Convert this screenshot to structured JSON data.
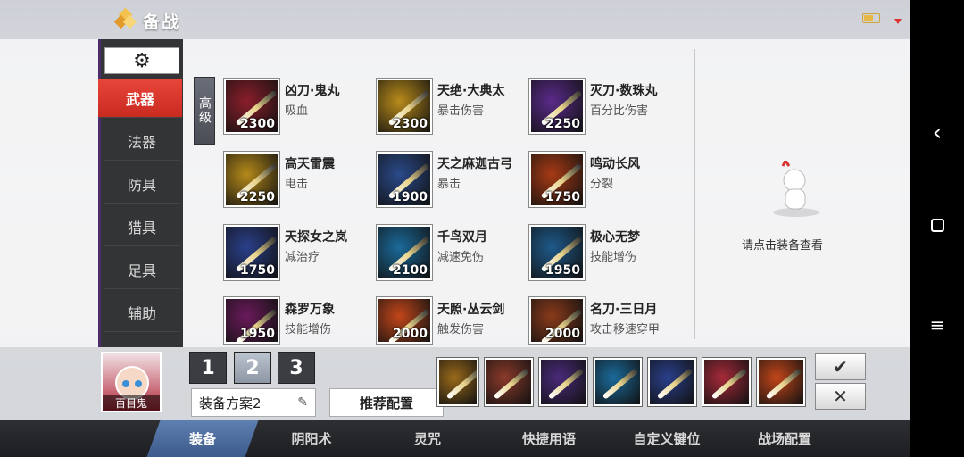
{
  "header": {
    "title": "备战"
  },
  "sidebar": {
    "settings_icon": "gear-icon",
    "categories": [
      "武器",
      "法器",
      "防具",
      "猎具",
      "足具",
      "辅助"
    ],
    "active": "武器"
  },
  "tier_tab": "高级",
  "items": [
    {
      "name": "凶刀·鬼丸",
      "desc": "吸血",
      "cost": "2300",
      "color": "#8a1e2a"
    },
    {
      "name": "天绝·大典太",
      "desc": "暴击伤害",
      "cost": "2300",
      "color": "#b98b1a"
    },
    {
      "name": "灭刀·数珠丸",
      "desc": "百分比伤害",
      "cost": "2250",
      "color": "#5a2a8a"
    },
    {
      "name": "高天雷震",
      "desc": "电击",
      "cost": "2250",
      "color": "#b58a1a"
    },
    {
      "name": "天之麻迦古弓",
      "desc": "暴击",
      "cost": "1900",
      "color": "#2a4a8a"
    },
    {
      "name": "鸣动长风",
      "desc": "分裂",
      "cost": "1750",
      "color": "#a63a14"
    },
    {
      "name": "天探女之岚",
      "desc": "减治疗",
      "cost": "1750",
      "color": "#2a3f8a"
    },
    {
      "name": "千鸟双月",
      "desc": "减速免伤",
      "cost": "2100",
      "color": "#1a6a9a"
    },
    {
      "name": "极心无梦",
      "desc": "技能增伤",
      "cost": "1950",
      "color": "#1e5a8a"
    },
    {
      "name": "森罗万象",
      "desc": "技能增伤",
      "cost": "1950",
      "color": "#6a1a5a"
    },
    {
      "name": "天照·丛云剑",
      "desc": "触发伤害",
      "cost": "2000",
      "color": "#c2461a"
    },
    {
      "name": "名刀·三日月",
      "desc": "攻击移速穿甲",
      "cost": "2000",
      "color": "#8a3a1a"
    }
  ],
  "detail": {
    "hint": "请点击装备查看"
  },
  "bottom": {
    "hero_name": "百目鬼",
    "plan_numbers": [
      "1",
      "2",
      "3"
    ],
    "active_plan": "2",
    "plan_name": "装备方案2",
    "recommend_label": "推荐配置",
    "slots": [
      "#9a6a1a",
      "#8a3a2a",
      "#4a2a7a",
      "#1a6a9a",
      "#2a3f8a",
      "#a62a3a",
      "#c2461a"
    ],
    "confirm_icon": "check-icon",
    "cancel_icon": "close-icon"
  },
  "tabs": [
    "装备",
    "阴阳术",
    "灵咒",
    "快捷用语",
    "自定义键位",
    "战场配置"
  ],
  "active_tab": "装备"
}
